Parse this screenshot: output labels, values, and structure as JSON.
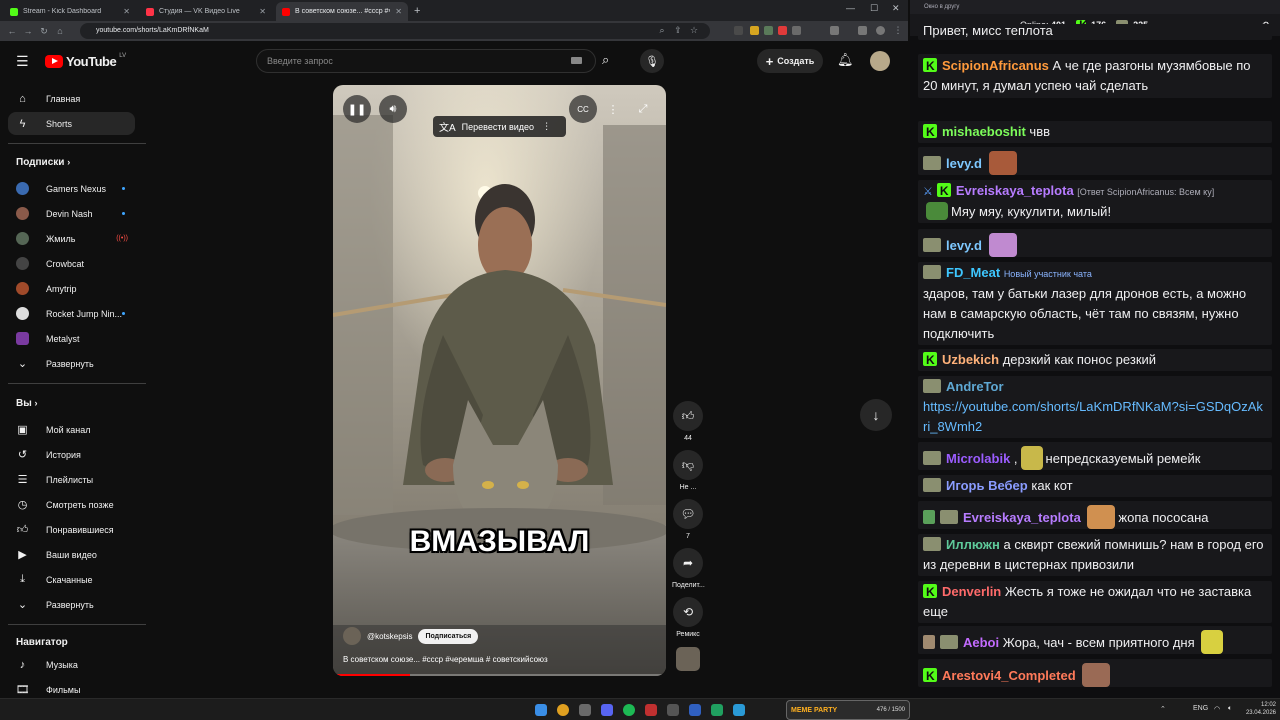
{
  "browser": {
    "tabs": [
      {
        "title": "Stream - Kick Dashboard",
        "color": "#53fc18"
      },
      {
        "title": "Студия — VK Видео Live",
        "color": "#ff3347"
      },
      {
        "title": "В советском союзе... #ссср #черемша",
        "color": "#ff0000",
        "active": true
      }
    ],
    "url": "youtube.com/shorts/LaKmDRfNKaM"
  },
  "youtube": {
    "logo_text": "YouTube",
    "logo_region": "LV",
    "search_placeholder": "Введите запрос",
    "create_label": "Создать",
    "guide": {
      "main": [
        {
          "label": "Главная",
          "icon": "home-icon"
        },
        {
          "label": "Shorts",
          "icon": "shorts-icon",
          "selected": true
        }
      ],
      "subscriptions_title": "Подписки",
      "subscriptions": [
        {
          "label": "Gamers Nexus",
          "avatar": "#3a6ab0",
          "badge": "dot"
        },
        {
          "label": "Devin Nash",
          "avatar": "#8a5a4a",
          "badge": "dot"
        },
        {
          "label": "Жмиль",
          "avatar": "#556655",
          "badge": "live"
        },
        {
          "label": "Crowbcat",
          "avatar": "#444444",
          "badge": ""
        },
        {
          "label": "Amytrip",
          "avatar": "#a04a2a",
          "badge": ""
        },
        {
          "label": "Rocket Jump Nin...",
          "avatar": "#dddddd",
          "badge": "dot"
        },
        {
          "label": "Metalyst",
          "avatar": "#7a3aa0",
          "badge": ""
        }
      ],
      "expand_label": "Развернуть",
      "you_title": "Вы",
      "you": [
        {
          "label": "Мой канал",
          "icon": "channel-icon"
        },
        {
          "label": "История",
          "icon": "history-icon"
        },
        {
          "label": "Плейлисты",
          "icon": "playlists-icon"
        },
        {
          "label": "Смотреть позже",
          "icon": "watch-later-icon"
        },
        {
          "label": "Понравившиеся",
          "icon": "like-icon"
        },
        {
          "label": "Ваши видео",
          "icon": "your-videos-icon"
        },
        {
          "label": "Скачанные",
          "icon": "download-icon"
        },
        {
          "label": "Развернуть",
          "icon": "chevron-down-icon"
        }
      ],
      "navigator_title": "Навигатор",
      "navigator": [
        {
          "label": "Музыка",
          "icon": "music-icon"
        },
        {
          "label": "Фильмы",
          "icon": "film-icon"
        }
      ]
    },
    "short": {
      "translate_label": "Перевести видео",
      "caption": "ВМАЗЫВАЛ",
      "channel": "@kotskepsis",
      "subscribe_label": "Подписаться",
      "title": "В советском союзе... #ссср #черемша # советскийсоюз",
      "progress": 0.23
    },
    "actions": {
      "likes": "44",
      "dislike_label": "Не ...",
      "comments": "7",
      "share_label": "Поделит...",
      "remix_label": "Ремикс"
    }
  },
  "chat": {
    "window_title": "Окно в другу",
    "online_label": "Online:",
    "online_count": "401",
    "kick_count": "176",
    "vk_count": "225",
    "top_partial": "Привет, мисс теплота",
    "messages": [
      {
        "user": "ScipionAfricanus",
        "color": "#ff9a3c",
        "badge": "kick",
        "text": "А че где разгоны музямбовые по 20 минут, я думал успею чай сделать"
      },
      {
        "user": "mishaeboshit",
        "color": "#7cfc5a",
        "badge": "kick",
        "text": "чвв"
      },
      {
        "user": "levy.d",
        "color": "#7ec8ff",
        "badge": "vk",
        "text": ""
      },
      {
        "user": "Evreiskaya_teplota",
        "color": "#b77cff",
        "badge": "kick",
        "reply": "[Ответ ScipionAfricanus: Всем ку]",
        "text": "Мяу мяу, кукулити, милый!"
      },
      {
        "user": "levy.d",
        "color": "#7ec8ff",
        "badge": "vk",
        "text": ""
      },
      {
        "user": "FD_Meat",
        "color": "#3ec7ff",
        "badge": "vk",
        "note": "Новый участник чата",
        "text": "здаров, там у батьки лазер для дронов есть, а можно нам в самарскую область, чёт там по связям, нужно подключить"
      },
      {
        "user": "Uzbekich",
        "color": "#ffb27a",
        "badge": "kick",
        "text": "дерзкий как понос резкий"
      },
      {
        "user": "AndreTor",
        "color": "#5fa8d3",
        "badge": "vk",
        "text": "https://youtube.com/shorts/LaKmDRfNKaM?si=GSDqOzAkri_8Wmh2"
      },
      {
        "user": "Microlabik",
        "color": "#9b5cff",
        "badge": "vk",
        "text": "непредсказуемый ремейк"
      },
      {
        "user": "Игорь Вебер",
        "color": "#8a9cff",
        "badge": "vk",
        "text": "как кот"
      },
      {
        "user": "Evreiskaya_teplota",
        "color": "#b77cff",
        "badge": "vk",
        "text": "жопа пососана"
      },
      {
        "user": "Иллюжн",
        "color": "#5ec99a",
        "badge": "vk",
        "text": "а сквирт свежий помнишь? нам в город его из деревни в цистернах привозили"
      },
      {
        "user": "Denverlin",
        "color": "#ff6b6b",
        "badge": "kick",
        "text": "Жесть я тоже не ожидал что не заставка еще"
      },
      {
        "user": "Aeboi",
        "color": "#c36bff",
        "badge": "vk",
        "text": "Жора, чач - всем приятного дня"
      },
      {
        "user": "Arestovi4_Completed",
        "color": "#ff7a5a",
        "badge": "kick",
        "text": ""
      }
    ]
  },
  "taskbar": {
    "overlay_label": "MEME PARTY",
    "overlay_count": "476 / 1500",
    "lang": "ENG",
    "time": "12:02",
    "date": "23.04.2026"
  }
}
